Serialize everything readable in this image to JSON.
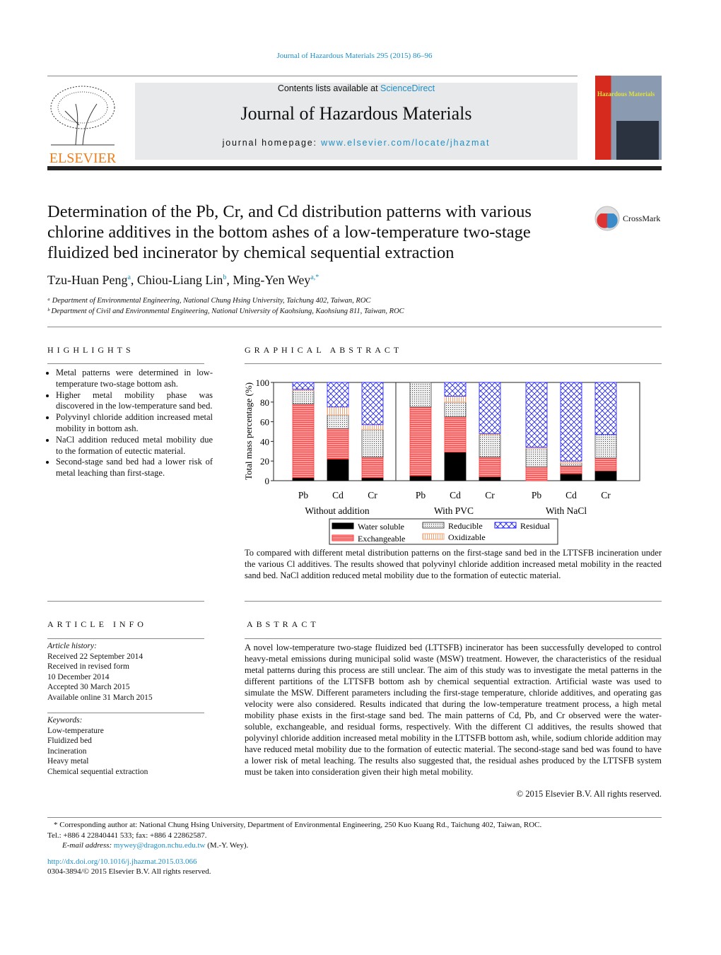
{
  "running_header": "Journal of Hazardous Materials 295 (2015) 86–96",
  "masthead": {
    "contents_prefix": "Contents lists available at ",
    "sciencedirect": "ScienceDirect",
    "journal": "Journal of Hazardous Materials",
    "homepage_prefix": "journal homepage: ",
    "homepage_url": "www.elsevier.com/locate/jhazmat",
    "publisher": "ELSEVIER",
    "cover_text": "Hazardous Materials",
    "crossmark": "CrossMark"
  },
  "title": "Determination of the Pb, Cr, and Cd distribution patterns with various chlorine additives in the bottom ashes of a low-temperature two-stage fluidized bed incinerator by chemical sequential extraction",
  "authors": [
    {
      "name": "Tzu-Huan Peng",
      "sup": "a"
    },
    {
      "name": "Chiou-Liang Lin",
      "sup": "b"
    },
    {
      "name": "Ming-Yen Wey",
      "sup": "a,*"
    }
  ],
  "affiliations": [
    "ᵃ Department of Environmental Engineering, National Chung Hsing University, Taichung 402, Taiwan, ROC",
    "ᵇ Department of Civil and Environmental Engineering, National University of Kaohsiung, Kaohsiung 811, Taiwan, ROC"
  ],
  "highlights": {
    "heading": "HIGHLIGHTS",
    "items": [
      "Metal patterns were determined in low-temperature two-stage bottom ash.",
      "Higher metal mobility phase was discovered in the low-temperature sand bed.",
      "Polyvinyl chloride addition increased metal mobility in bottom ash.",
      "NaCl addition reduced metal mobility due to the formation of eutectic material.",
      "Second-stage sand bed had a lower risk of metal leaching than first-stage."
    ]
  },
  "graphical_abstract": {
    "heading": "GRAPHICAL ABSTRACT",
    "caption": "To compared with different metal distribution patterns on the first-stage sand bed in the LTTSFB incineration under the various Cl additives. The results showed that polyvinyl chloride addition increased metal mobility in the reacted sand bed. NaCl addition reduced metal mobility due to the formation of eutectic material."
  },
  "chart_data": {
    "type": "bar",
    "stacked": true,
    "ylabel": "Total mass percentage (%)",
    "ylim": [
      0,
      100
    ],
    "yticks": [
      0,
      20,
      40,
      60,
      80,
      100
    ],
    "groups": [
      "Without addition",
      "With PVC",
      "With NaCl"
    ],
    "categories": [
      "Pb",
      "Cd",
      "Cr",
      "Pb",
      "Cd",
      "Cr",
      "Pb",
      "Cd",
      "Cr"
    ],
    "legend_placement": "bottom",
    "series": [
      {
        "name": "Water soluble",
        "color": "#000000",
        "values": [
          3,
          22,
          3,
          5,
          29,
          4,
          0,
          7,
          10
        ]
      },
      {
        "name": "Exchangeable",
        "color": "#f06060",
        "values": [
          75,
          31,
          21,
          70,
          36,
          20,
          14,
          8,
          13
        ]
      },
      {
        "name": "Reducible",
        "color": "#555555",
        "values": [
          14,
          14,
          28,
          25,
          15,
          23,
          19,
          3,
          24
        ]
      },
      {
        "name": "Oxidizable",
        "color": "#f5a070",
        "values": [
          1,
          8,
          5,
          0,
          6,
          1,
          1,
          2,
          0
        ]
      },
      {
        "name": "Residual",
        "color": "#1a1aff",
        "values": [
          7,
          25,
          43,
          0,
          14,
          52,
          66,
          80,
          53
        ]
      }
    ]
  },
  "article_info": {
    "heading": "ARTICLE INFO",
    "history_label": "Article history:",
    "history": [
      "Received 22 September 2014",
      "Received in revised form",
      "10 December 2014",
      "Accepted 30 March 2015",
      "Available online 31 March 2015"
    ],
    "keywords_label": "Keywords:",
    "keywords": [
      "Low-temperature",
      "Fluidized bed",
      "Incineration",
      "Heavy metal",
      "Chemical sequential extraction"
    ]
  },
  "abstract": {
    "heading": "ABSTRACT",
    "text": "A novel low-temperature two-stage fluidized bed (LTTSFB) incinerator has been successfully developed to control heavy-metal emissions during municipal solid waste (MSW) treatment. However, the characteristics of the residual metal patterns during this process are still unclear. The aim of this study was to investigate the metal patterns in the different partitions of the LTTSFB bottom ash by chemical sequential extraction. Artificial waste was used to simulate the MSW. Different parameters including the first-stage temperature, chloride additives, and operating gas velocity were also considered. Results indicated that during the low-temperature treatment process, a high metal mobility phase exists in the first-stage sand bed. The main patterns of Cd, Pb, and Cr observed were the water-soluble, exchangeable, and residual forms, respectively. With the different Cl additives, the results showed that polyvinyl chloride addition increased metal mobility in the LTTSFB bottom ash, while, sodium chloride addition may have reduced metal mobility due to the formation of eutectic material. The second-stage sand bed was found to have a lower risk of metal leaching. The results also suggested that, the residual ashes produced by the LTTSFB system must be taken into consideration given their high metal mobility.",
    "copyright": "© 2015 Elsevier B.V. All rights reserved."
  },
  "footnotes": {
    "corresponding": "* Corresponding author at: National Chung Hsing University, Department of Environmental Engineering, 250 Kuo Kuang Rd., Taichung 402, Taiwan, ROC.",
    "tel": "Tel.: +886 4 22840441 533; fax: +886 4 22862587.",
    "email_label": "E-mail address: ",
    "email": "mywey@dragon.nchu.edu.tw",
    "email_suffix": " (M.-Y. Wey).",
    "doi": "http://dx.doi.org/10.1016/j.jhazmat.2015.03.066",
    "issn": "0304-3894/© 2015 Elsevier B.V. All rights reserved."
  }
}
